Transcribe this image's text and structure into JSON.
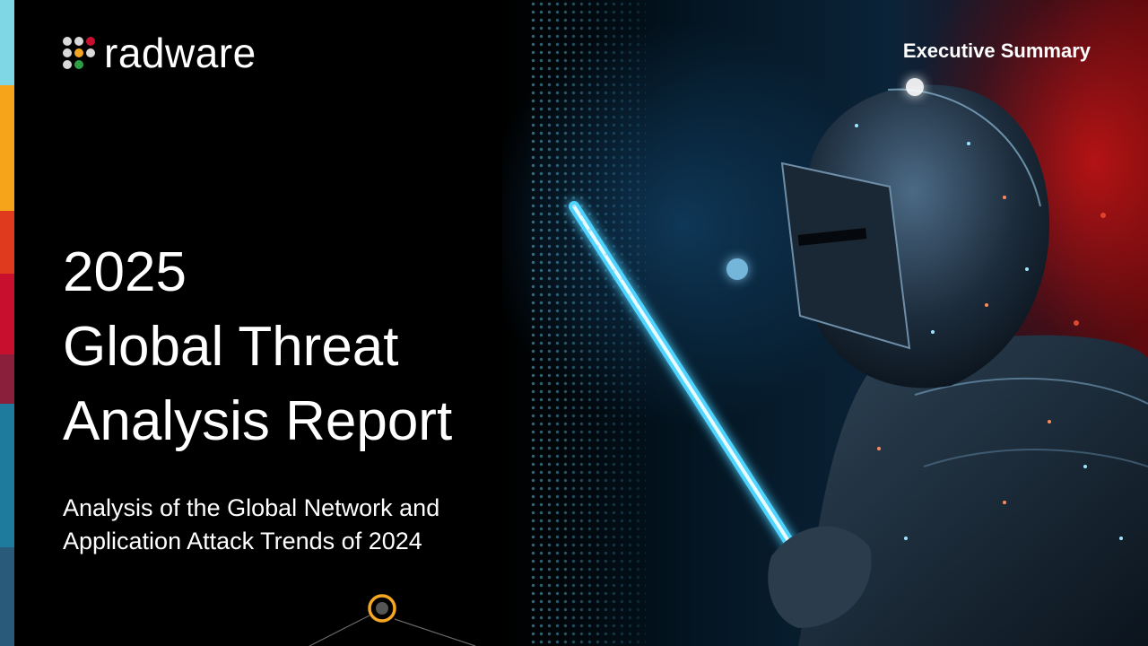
{
  "brand": {
    "name": "radware",
    "dot_colors": [
      "#d9d9d9",
      "#d9d9d9",
      "#c8102e",
      "#d9d9d9",
      "#f5a623",
      "#d9d9d9",
      "#d9d9d9",
      "#2e9e44",
      "#000000"
    ]
  },
  "header": {
    "section_label": "Executive Summary"
  },
  "title": {
    "lines": [
      "2025",
      "Global Threat",
      "Analysis Report"
    ]
  },
  "subtitle": {
    "lines": [
      "Analysis of the Global Network and",
      "Application Attack Trends of 2024"
    ]
  },
  "colors": {
    "background": "#000000",
    "text": "#ffffff",
    "accent_orange": "#f5a623",
    "accent_red": "#c8102e",
    "accent_cyan": "#4fd3ff"
  }
}
